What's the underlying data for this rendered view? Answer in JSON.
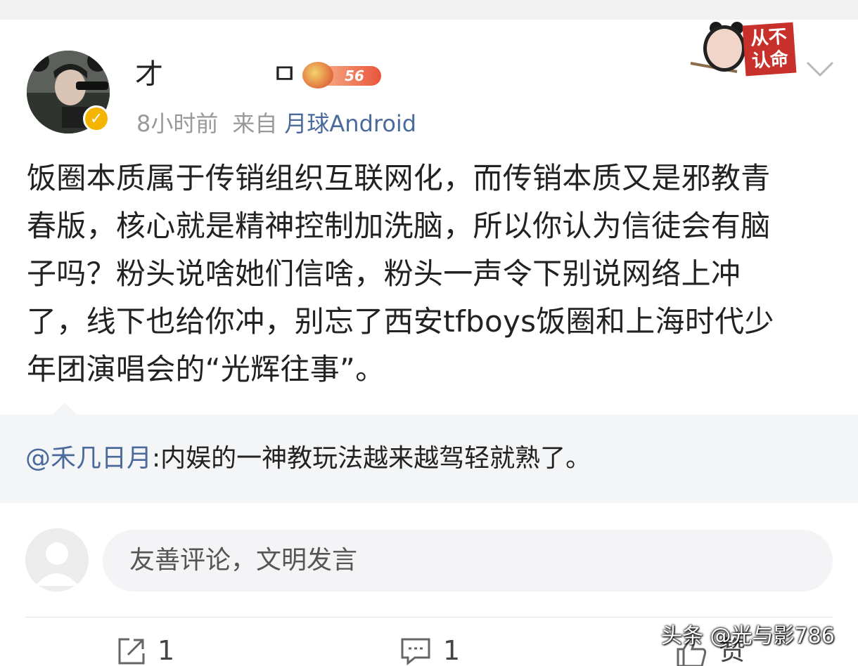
{
  "post": {
    "username_visible": [
      "才",
      "ㅁ"
    ],
    "level": "56",
    "meta": {
      "time": "8小时前",
      "from_label": "来自",
      "source": "月球Android"
    },
    "sticker_text": "从不认命",
    "body_lines": [
      "饭圈本质属于传销组织互联网化，而传销本质又是邪教青",
      "春版，核心就是精神控制加洗脑，所以你认为信徒会有脑",
      "子吗？粉头说啥她们信啥，粉头一声令下别说网络上冲",
      "了，线下也给你冲，别忘了西安tfboys饭圈和上海时代少",
      "年团演唱会的“光辉往事”。"
    ]
  },
  "repost": {
    "mention": "@禾几日月",
    "text": ":内娱的一神教玩法越来越驾轻就熟了。"
  },
  "comment": {
    "placeholder": "友善评论，文明发言"
  },
  "actions": {
    "share_count": "1",
    "comment_count": "1",
    "like_label": "赞"
  },
  "watermark": "头条 @光与影786",
  "colors": {
    "link_blue": "#4a6a9c",
    "meta_gray": "#999999",
    "repost_bg": "#f4f5f7",
    "verified_gold": "#f5b400"
  }
}
